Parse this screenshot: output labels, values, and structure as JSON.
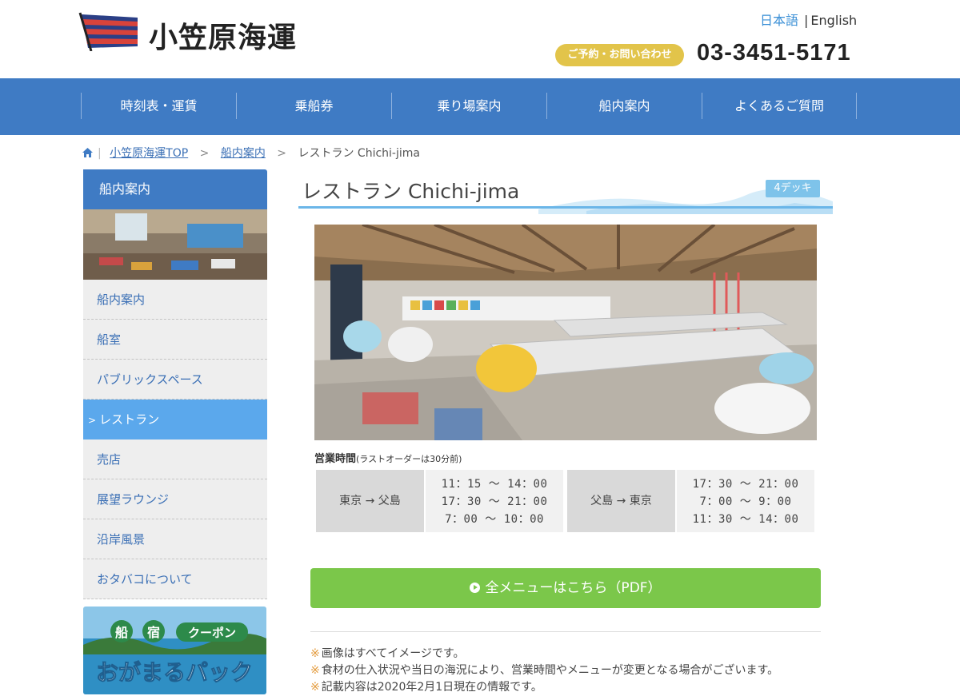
{
  "header": {
    "logo_text": "小笠原海運",
    "lang_ja": "日本語",
    "lang_sep": "|",
    "lang_en": "English",
    "contact_label": "ご予約・お問い合わせ",
    "phone": "03-3451-5171"
  },
  "nav": {
    "items": [
      "時刻表・運賃",
      "乗船券",
      "乗り場案内",
      "船内案内",
      "よくあるご質問"
    ]
  },
  "breadcrumb": {
    "top": "小笠原海運TOP",
    "level2": "船内案内",
    "current": "レストラン Chichi-jima",
    "arrow": ">"
  },
  "sidebar": {
    "heading": "船内案内",
    "items": [
      "船内案内",
      "船室",
      "パブリックスペース",
      "レストラン",
      "売店",
      "展望ラウンジ",
      "沿岸風景",
      "おタバコについて"
    ],
    "active_index": 3,
    "active_chevron": ">",
    "banner": {
      "chips": [
        "船",
        "宿",
        "クーポン"
      ],
      "title": "おがまるパック"
    }
  },
  "main": {
    "title": "レストラン Chichi-jima",
    "deck": "4デッキ",
    "hours_label": "営業時間",
    "hours_note": "(ラストオーダーは30分前)",
    "routes": [
      {
        "route": "東京 → 父島",
        "times": [
          "11：15 〜 14：00",
          "17：30 〜 21：00",
          "7：00 〜 10：00"
        ]
      },
      {
        "route": "父島 → 東京",
        "times": [
          "17：30 〜 21：00",
          "7：00 〜 9：00",
          "11：30 〜 14：00"
        ]
      }
    ],
    "menu_button": "全メニューはこちら（PDF）",
    "notes_mark": "※",
    "notes": [
      "画像はすべてイメージです。",
      "食材の仕入状況や当日の海況により、営業時間やメニューが変更となる場合がございます。",
      "記載内容は2020年2月1日現在の情報です。"
    ]
  },
  "colors": {
    "nav_bg": "#3f7bc4",
    "accent_blue": "#5ba8ec",
    "contact_gold": "#e2c44a",
    "menu_green": "#7bc74a"
  }
}
